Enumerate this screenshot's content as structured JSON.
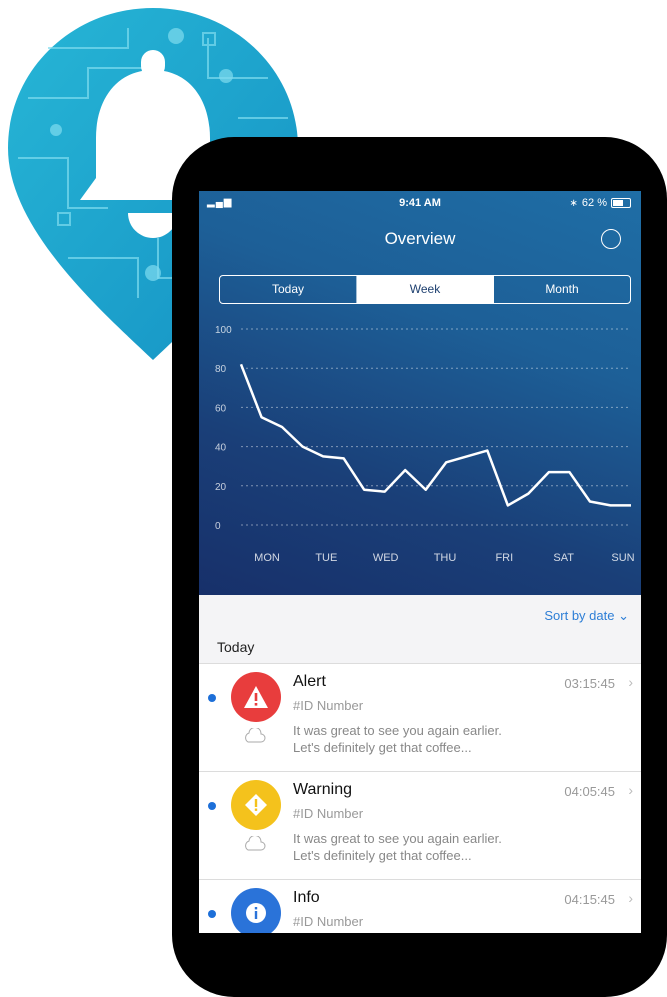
{
  "status": {
    "signal": "▂▄▆",
    "time": "9:41 AM",
    "battery": "62 %"
  },
  "header": {
    "title": "Overview"
  },
  "segments": [
    "Today",
    "Week",
    "Month"
  ],
  "active_segment": "Week",
  "chart_data": {
    "type": "line",
    "x": [
      "MON",
      "",
      "",
      "",
      "",
      "",
      "",
      "TUE",
      "",
      "",
      "",
      "",
      "WED",
      "",
      "",
      "",
      "",
      "",
      "THU",
      "",
      "",
      "",
      "FRI",
      "",
      "",
      "",
      "",
      "SAT",
      "",
      "",
      "",
      "SUN",
      "",
      ""
    ],
    "categories": [
      "MON",
      "TUE",
      "WED",
      "THU",
      "FRI",
      "SAT",
      "SUN"
    ],
    "series": [
      {
        "values": [
          82,
          55,
          50,
          40,
          35,
          34,
          18,
          17,
          28,
          18,
          32,
          35,
          38,
          10,
          16,
          27,
          27,
          12,
          10,
          10
        ]
      }
    ],
    "ylim": [
      0,
      100
    ],
    "yticks": [
      0,
      20,
      40,
      60,
      80,
      100
    ],
    "grid": true,
    "line_color": "#ffffff"
  },
  "sort": {
    "label": "Sort by date"
  },
  "section": {
    "label": "Today"
  },
  "items": [
    {
      "title": "Alert",
      "time": "03:15:45",
      "id": "#ID Number",
      "msg1": "It was great to see you again earlier.",
      "msg2": "Let's definitely get that coffee...",
      "color": "#e83d3d",
      "icon": "alert-triangle-icon"
    },
    {
      "title": "Warning",
      "time": "04:05:45",
      "id": "#ID Number",
      "msg1": "It was great to see you again earlier.",
      "msg2": "Let's definitely get that coffee...",
      "color": "#f4c21c",
      "icon": "warning-diamond-icon"
    },
    {
      "title": "Info",
      "time": "04:15:45",
      "id": "#ID Number",
      "color": "#2a73d9",
      "icon": "info-icon"
    }
  ],
  "colors": {
    "hero_top": "#1f6ea6",
    "hero_bottom": "#17306a",
    "accent": "#2d7ed6",
    "pin_teal": "#1fb0cf"
  }
}
